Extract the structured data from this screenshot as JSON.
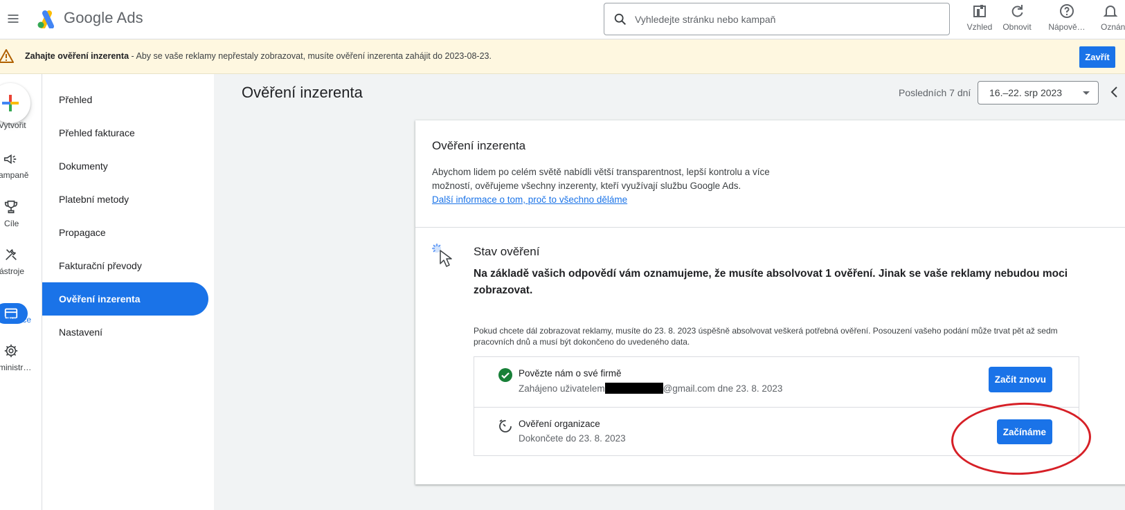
{
  "app": {
    "logo_text": "Google Ads"
  },
  "search": {
    "placeholder": "Vyhledejte stránku nebo kampaň"
  },
  "toolbar": {
    "appearance_label": "Vzhled",
    "refresh_label": "Obnovit",
    "help_label": "Nápově…",
    "notifications_label": "Oznán"
  },
  "banner": {
    "bold_text": "Zahajte ověření inzerenta",
    "text": " - Aby se vaše reklamy nepřestaly zobrazovat, musíte ověření inzerenta zahájit do 2023-08-23.",
    "close_label": "Zavřít"
  },
  "rail": {
    "items": [
      {
        "label": "Vytvořit",
        "icon": "plus-icon"
      },
      {
        "label": "Kampaně",
        "icon": "megaphone-icon"
      },
      {
        "label": "Cíle",
        "icon": "trophy-icon"
      },
      {
        "label": "Nástroje",
        "icon": "tools-icon"
      },
      {
        "label": "Fakturace",
        "icon": "credit-card-icon"
      },
      {
        "label": "Administrace",
        "icon": "gear-icon"
      }
    ],
    "visible_labels": [
      "Vytvořit",
      "ampaně",
      "Cíle",
      "ástroje",
      "akturace",
      "ministr…"
    ],
    "active_color": "#1a73e8"
  },
  "subnav": {
    "items": [
      {
        "label": "Přehled"
      },
      {
        "label": "Přehled fakturace"
      },
      {
        "label": "Dokumenty"
      },
      {
        "label": "Platební metody"
      },
      {
        "label": "Propagace"
      },
      {
        "label": "Fakturační převody"
      },
      {
        "label": "Ověření inzerenta",
        "active": true
      },
      {
        "label": "Nastavení"
      }
    ]
  },
  "main": {
    "page_title": "Ověření inzerenta",
    "range_label": "Posledních 7 dní",
    "date_value": "16.–22. srp 2023"
  },
  "card": {
    "title": "Ověření inzerenta",
    "description_line1": "Abychom lidem po celém světě nabídli větší transparentnost, lepší kontrolu a více",
    "description_line2": "možností, ověřujeme všechny inzerenty, kteří využívají službu Google Ads.",
    "link_text": "Další informace o tom, proč to všechno děláme",
    "status_title": "Stav ověření",
    "status_bold": "Na základě vašich odpovědí vám oznamujeme, že musíte absolvovat 1 ověření. Jinak se vaše reklamy nebudou moci zobrazovat.",
    "status_note": "Pokud chcete dál zobrazovat reklamy, musíte do 23. 8. 2023 úspěšně absolvovat veškerá potřebná ověření. Posouzení vašeho podání může trvat pět až sedm pracovních dnů a musí být dokončeno do uvedeného data.",
    "steps": [
      {
        "title": "Povězte nám o své firmě",
        "sub_prefix": "Zahájeno uživatelem",
        "sub_suffix": "@gmail.com dne 23. 8. 2023",
        "button": "Začít znovu",
        "status_icon": "check-circle-icon",
        "status_color": "#188038"
      },
      {
        "title": "Ověření organizace",
        "sub_prefix": "Dokončete do 23. 8. 2023",
        "sub_suffix": "",
        "button": "Začínáme",
        "status_icon": "timer-icon"
      }
    ]
  },
  "colors": {
    "accent": "#1a73e8",
    "banner_bg": "#fef7e0",
    "annotation": "#d62027"
  }
}
